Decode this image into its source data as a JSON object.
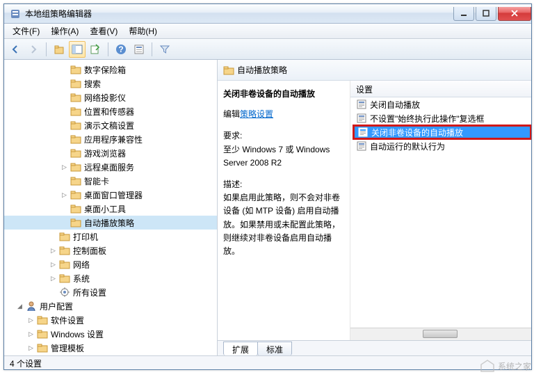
{
  "window": {
    "title": "本地组策略编辑器"
  },
  "menu": {
    "file": "文件(F)",
    "action": "操作(A)",
    "view": "查看(V)",
    "help": "帮助(H)"
  },
  "tree": {
    "items": [
      {
        "label": "数字保险箱",
        "indent": 5,
        "expand": ""
      },
      {
        "label": "搜索",
        "indent": 5,
        "expand": ""
      },
      {
        "label": "网络投影仪",
        "indent": 5,
        "expand": ""
      },
      {
        "label": "位置和传感器",
        "indent": 5,
        "expand": ""
      },
      {
        "label": "演示文稿设置",
        "indent": 5,
        "expand": ""
      },
      {
        "label": "应用程序兼容性",
        "indent": 5,
        "expand": ""
      },
      {
        "label": "游戏浏览器",
        "indent": 5,
        "expand": ""
      },
      {
        "label": "远程桌面服务",
        "indent": 5,
        "expand": "▷"
      },
      {
        "label": "智能卡",
        "indent": 5,
        "expand": ""
      },
      {
        "label": "桌面窗口管理器",
        "indent": 5,
        "expand": "▷"
      },
      {
        "label": "桌面小工具",
        "indent": 5,
        "expand": ""
      },
      {
        "label": "自动播放策略",
        "indent": 5,
        "expand": "",
        "selected": true
      },
      {
        "label": "打印机",
        "indent": 4,
        "expand": ""
      },
      {
        "label": "控制面板",
        "indent": 4,
        "expand": "▷"
      },
      {
        "label": "网络",
        "indent": 4,
        "expand": "▷"
      },
      {
        "label": "系统",
        "indent": 4,
        "expand": "▷"
      },
      {
        "label": "所有设置",
        "indent": 4,
        "expand": "",
        "icon": "settings"
      },
      {
        "label": "用户配置",
        "indent": 1,
        "expand": "◢",
        "icon": "user"
      },
      {
        "label": "软件设置",
        "indent": 2,
        "expand": "▷"
      },
      {
        "label": "Windows 设置",
        "indent": 2,
        "expand": "▷"
      },
      {
        "label": "管理模板",
        "indent": 2,
        "expand": "▷"
      }
    ]
  },
  "right": {
    "header": "自动播放策略",
    "desc_title": "关闭非卷设备的自动播放",
    "edit_prefix": "编辑",
    "edit_link": "策略设置",
    "req_label": "要求:",
    "req_text": "至少 Windows 7 或 Windows Server 2008 R2",
    "desc_label": "描述:",
    "desc_text": "如果启用此策略，则不会对非卷设备 (如 MTP 设备) 启用自动播放。如果禁用或未配置此策略，则继续对非卷设备启用自动播放。",
    "col_header": "设置",
    "settings": [
      {
        "label": "关闭自动播放"
      },
      {
        "label": "不设置\"始终执行此操作\"复选框"
      },
      {
        "label": "关闭非卷设备的自动播放",
        "selected": true
      },
      {
        "label": "自动运行的默认行为"
      }
    ]
  },
  "tabs": {
    "extended": "扩展",
    "standard": "标准"
  },
  "status": "4 个设置",
  "watermark": "系统之家"
}
